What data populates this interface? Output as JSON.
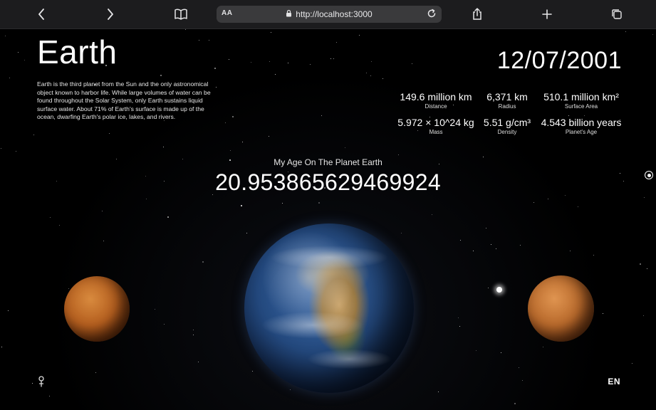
{
  "browser": {
    "text_size_label": "AA",
    "url": "http://localhost:3000",
    "icons": [
      "back-icon",
      "forward-icon",
      "bookmarks-icon",
      "lock-icon",
      "reload-icon",
      "share-icon",
      "new-tab-icon",
      "tabs-icon"
    ]
  },
  "planet": {
    "name": "Earth",
    "description": "Earth is the third planet from the Sun and the only astronomical object known to harbor life. While large volumes of water can be found throughout the Solar System, only Earth sustains liquid surface water. About 71% of Earth's surface is made up of the ocean, dwarfing Earth's polar ice, lakes, and rivers.",
    "date": "12/07/2001"
  },
  "stats": [
    {
      "value": "149.6 million km",
      "label": "Distance"
    },
    {
      "value": "6,371 km",
      "label": "Radius"
    },
    {
      "value": "510.1 million km²",
      "label": "Surface Area"
    },
    {
      "value": "5.972 × 10^24 kg",
      "label": "Mass"
    },
    {
      "value": "5.51 g/cm³",
      "label": "Density"
    },
    {
      "value": "4.543 billion years",
      "label": "Planet's Age"
    }
  ],
  "age": {
    "label": "My Age On The Planet Earth",
    "value": "20.953865629469924"
  },
  "footer": {
    "language": "EN"
  },
  "colors": {
    "toolbar": "#1c1c1e",
    "urlbar": "#3a3a3c",
    "background": "#000000",
    "text": "#ffffff"
  }
}
